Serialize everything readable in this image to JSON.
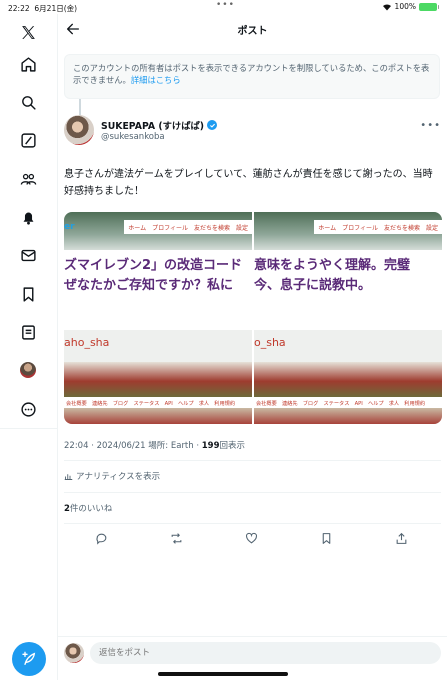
{
  "status_bar": {
    "time": "22:22",
    "date": "6月21日(金)",
    "battery": "100%"
  },
  "header": {
    "title": "ポスト"
  },
  "notice": {
    "text": "このアカウントの所有者はポストを表示できるアカウントを制限しているため、このポストを表示できません。",
    "link": "詳細はこちら"
  },
  "tweet": {
    "author_name": "SUKEPAPA (すけぱぱ)",
    "author_handle": "@sukesankoba",
    "text": "息子さんが違法ゲームをプレイしていて、蓮舫さんが責任を感じて謝ったの、当時好感持ちました！",
    "meta_time": "22:04 · 2024/06/21 場所: Earth · ",
    "views_count": "199",
    "views_label": "回表示",
    "analytics_label": "アナリティクスを表示",
    "likes_count": "2",
    "likes_label": "件のいいね"
  },
  "media": {
    "left": {
      "menu": "ホーム　プロフィール　友だちを検索　設定",
      "logo": "er",
      "line1": "ズマイレブン2」の改造コード",
      "line2": "ぜなたかご存知ですか？私に",
      "handle": "aho_sha",
      "footer": "会社概要　連絡先　ブログ　ステータス　API　ヘルプ　求人　利用規約"
    },
    "right": {
      "menu": "ホーム　プロフィール　友だちを検索　設定",
      "line1": "意味をようやく理解。完璧",
      "line2": "今、息子に説教中。",
      "handle": "o_sha",
      "footer": "会社概要　連絡先　ブログ　ステータス　API　ヘルプ　求人　利用規約"
    }
  },
  "reply": {
    "placeholder": "返信をポスト"
  },
  "icons": {
    "sidebar": [
      "x-logo-icon",
      "home-icon",
      "search-icon",
      "grok-icon",
      "communities-icon",
      "notifications-icon",
      "messages-icon",
      "bookmarks-icon",
      "lists-icon",
      "profile-avatar",
      "more-icon"
    ],
    "actions": [
      "reply-icon",
      "repost-icon",
      "like-icon",
      "bookmark-icon",
      "share-icon"
    ]
  },
  "colors": {
    "accent": "#1d9bf0",
    "text": "#0f1419",
    "muted": "#536471"
  }
}
